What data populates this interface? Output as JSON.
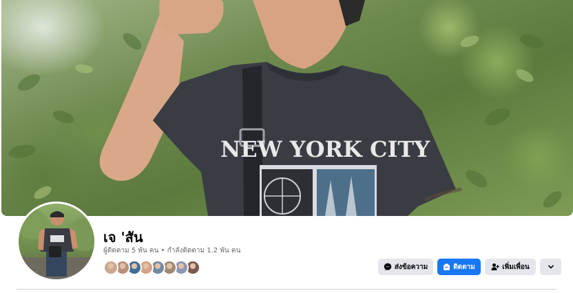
{
  "profile": {
    "name": "เจ 'สัน",
    "followers_text": "ผู้ติดตาม 5 พัน คน",
    "separator": "•",
    "following_text": "กำลังติดตาม 1.2 พัน คน"
  },
  "cover": {
    "shirt_text": "NEW YORK CITY"
  },
  "mutual_friends": [
    {
      "color": "#c9a88f"
    },
    {
      "color": "#b98f7a"
    },
    {
      "color": "#3f6f93"
    },
    {
      "color": "#d6a184"
    },
    {
      "color": "#6f8aa0"
    },
    {
      "color": "#a08a76"
    },
    {
      "color": "#8c97b5"
    },
    {
      "color": "#7a5a4e"
    }
  ],
  "actions": {
    "message_label": "ส่งข้อความ",
    "follow_label": "ติดตาม",
    "add_friend_label": "เพิ่มเพื่อน"
  },
  "colors": {
    "primary_blue": "#1877f2",
    "button_gray": "#e4e6eb",
    "secondary_text": "#65676b"
  }
}
